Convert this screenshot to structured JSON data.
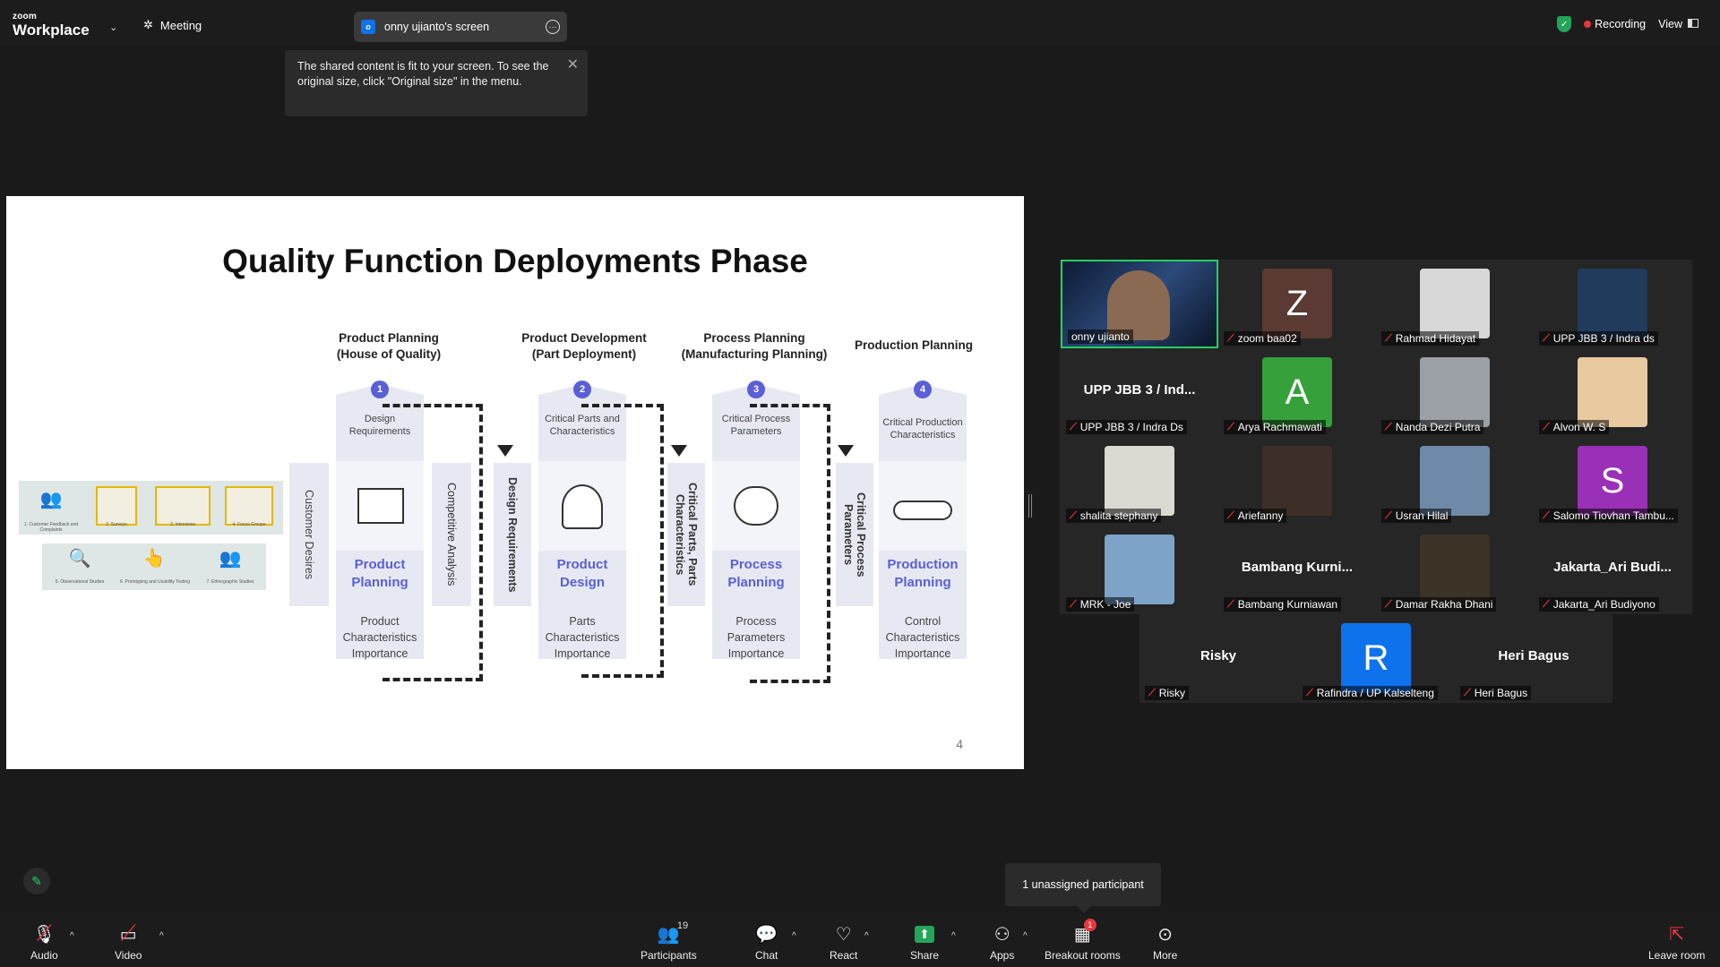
{
  "topbar": {
    "brand_small": "zoom",
    "brand_big": "Workplace",
    "meeting_label": "Meeting",
    "share_label": "onny ujianto's screen",
    "tooltip_text": "The shared content is fit to your screen. To see the original size, click \"Original size\" in the menu.",
    "recording_label": "Recording",
    "view_label": "View"
  },
  "slide": {
    "title": "Quality Function Deployments Phase",
    "page_number": "4",
    "phases": [
      {
        "header": "Product Planning (House of Quality)",
        "number": "1",
        "top_label": "Design Requirements",
        "main_label": "Product Planning",
        "bottom_label": "Product Characteristics Importance",
        "left_vertical": "Customer Desires",
        "right_vertical": "Competitive Analysis"
      },
      {
        "header": "Product Development (Part Deployment)",
        "number": "2",
        "top_label": "Critical Parts and Characteristics",
        "main_label": "Product Design",
        "bottom_label": "Parts Characteristics Importance",
        "left_vertical": "Design Requirements"
      },
      {
        "header": "Process Planning (Manufacturing Planning)",
        "number": "3",
        "top_label": "Critical Process Parameters",
        "main_label": "Process Planning",
        "bottom_label": "Process Parameters Importance",
        "left_vertical": "Critical Parts, Parts Characteristics"
      },
      {
        "header": "Production Planning",
        "number": "4",
        "top_label": "Critical Production Characteristics",
        "main_label": "Production Planning",
        "bottom_label": "Control Characteristics Importance",
        "left_vertical": "Critical Process Parameters"
      }
    ],
    "thumbnails": [
      "1. Customer Feedback and Complaints",
      "2. Surveys",
      "3. Interviews",
      "4. Focus Groups",
      "5. Observational Studies",
      "6. Prototyping and Usability Testing",
      "7. Ethnographic Studies"
    ]
  },
  "gallery": {
    "participants": [
      {
        "name": "onny ujianto",
        "type": "video",
        "muted": false
      },
      {
        "name": "zoom baa02",
        "type": "letter",
        "letter": "Z",
        "color": "#5a3a33",
        "muted": true
      },
      {
        "name": "Rahmad Hidayat",
        "type": "photo",
        "color": "#d8d8d8",
        "muted": true
      },
      {
        "name": "UPP JBB 3 / Indra ds",
        "type": "photo",
        "color": "#203b5c",
        "muted": true
      },
      {
        "name": "UPP JBB 3 / Indra Ds",
        "type": "text",
        "display": "UPP JBB 3 / Ind...",
        "muted": true
      },
      {
        "name": "Arya Rachmawati",
        "type": "letter",
        "letter": "A",
        "color": "#36a13a",
        "muted": true
      },
      {
        "name": "Nanda Dezi Putra",
        "type": "photo",
        "color": "#9aa0a6",
        "muted": true
      },
      {
        "name": "Alvon W. S",
        "type": "photo",
        "color": "#e8c9a0",
        "muted": true
      },
      {
        "name": "shalita stephany",
        "type": "photo",
        "color": "#dcd8d2",
        "muted": true
      },
      {
        "name": "Ariefanny",
        "type": "photo",
        "color": "#3d2f28",
        "muted": true
      },
      {
        "name": "Usran Hilal",
        "type": "photo",
        "color": "#6e8aa8",
        "muted": true
      },
      {
        "name": "Salomo Tiovhan Tambu...",
        "type": "letter",
        "letter": "S",
        "color": "#9b30b8",
        "muted": true
      },
      {
        "name": "MRK - Joe",
        "type": "photo",
        "color": "#7da3c9",
        "muted": true
      },
      {
        "name": "Bambang Kurniawan",
        "type": "text",
        "display": "Bambang  Kurni...",
        "muted": true
      },
      {
        "name": "Damar Rakha Dhani",
        "type": "photo",
        "color": "#3a3326",
        "muted": true
      },
      {
        "name": "Jakarta_Ari Budiyono",
        "type": "text",
        "display": "Jakarta_Ari  Budi...",
        "muted": true
      },
      {
        "name": "Risky",
        "type": "text",
        "display": "Risky",
        "muted": true
      },
      {
        "name": "Rafindra / UP Kalselteng",
        "type": "letter",
        "letter": "R",
        "color": "#0e72ed",
        "muted": true
      },
      {
        "name": "Heri Bagus",
        "type": "text",
        "display": "Heri Bagus",
        "muted": true
      }
    ]
  },
  "unassigned_tooltip": "1 unassigned participant",
  "toolbar": {
    "audio": "Audio",
    "video": "Video",
    "participants": "Participants",
    "participants_count": "19",
    "chat": "Chat",
    "react": "React",
    "share": "Share",
    "apps": "Apps",
    "breakout": "Breakout rooms",
    "breakout_badge": "1",
    "more": "More",
    "leave": "Leave room"
  },
  "colors": {
    "accent_purple": "#5b5fd6",
    "recording_red": "#e8383d",
    "active_green": "#23d160",
    "share_green": "#23a55a"
  }
}
